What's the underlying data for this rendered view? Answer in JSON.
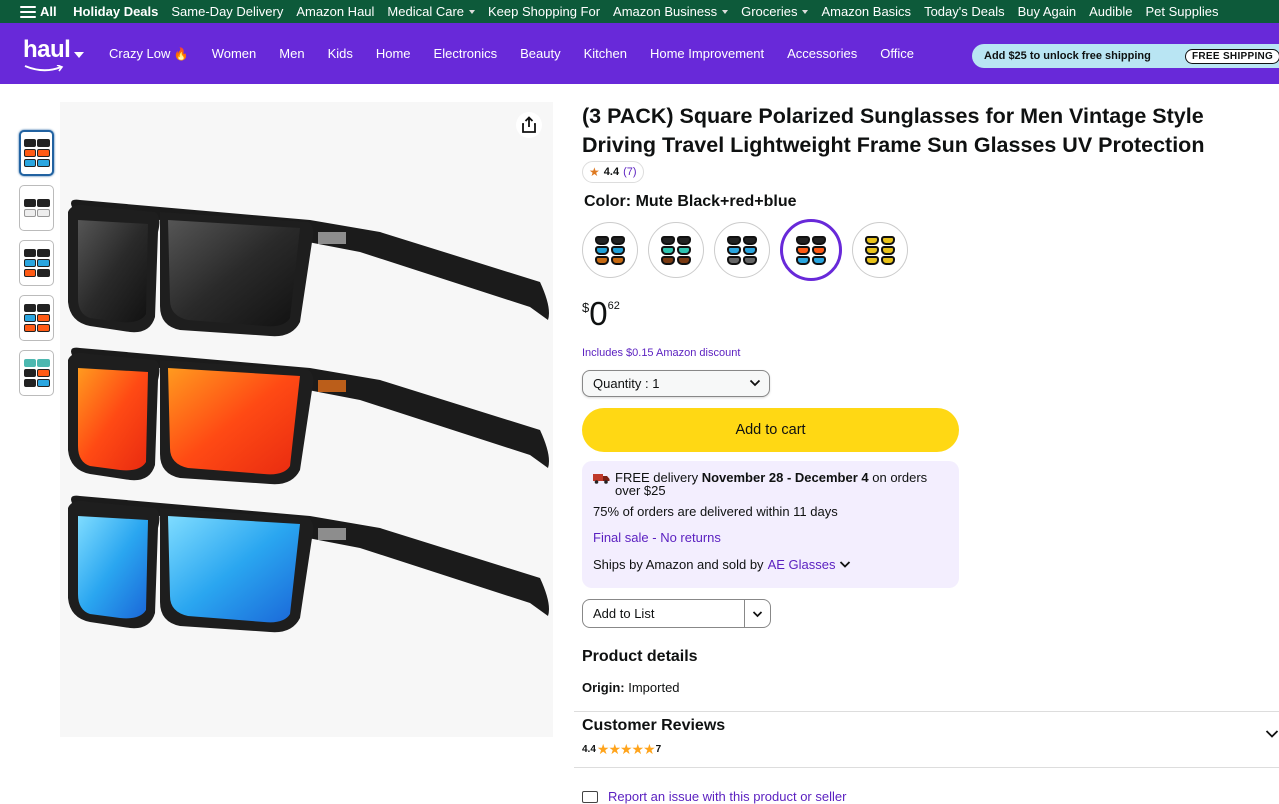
{
  "topnav": {
    "all_label": "All",
    "items": [
      {
        "label": "Holiday Deals",
        "bold": true,
        "caret": false
      },
      {
        "label": "Same-Day Delivery",
        "bold": false,
        "caret": false
      },
      {
        "label": "Amazon Haul",
        "bold": false,
        "caret": false
      },
      {
        "label": "Medical Care",
        "bold": false,
        "caret": true
      },
      {
        "label": "Keep Shopping For",
        "bold": false,
        "caret": false
      },
      {
        "label": "Amazon Business",
        "bold": false,
        "caret": true
      },
      {
        "label": "Groceries",
        "bold": false,
        "caret": true
      },
      {
        "label": "Amazon Basics",
        "bold": false,
        "caret": false
      },
      {
        "label": "Today's Deals",
        "bold": false,
        "caret": false
      },
      {
        "label": "Buy Again",
        "bold": false,
        "caret": false
      },
      {
        "label": "Audible",
        "bold": false,
        "caret": false
      },
      {
        "label": "Pet Supplies",
        "bold": false,
        "caret": false
      }
    ]
  },
  "haulbar": {
    "logo": "haul",
    "categories": [
      "Crazy Low",
      "Women",
      "Men",
      "Kids",
      "Home",
      "Electronics",
      "Beauty",
      "Kitchen",
      "Home Improvement",
      "Accessories",
      "Office"
    ],
    "shipping_banner": "Add $25 to unlock free shipping",
    "shipping_pill": "FREE SHIPPING"
  },
  "product": {
    "title": "(3 PACK) Square Polarized Sunglasses for Men Vintage Style Driving Travel Lightweight Frame Sun Glasses UV Protection",
    "rating": "4.4",
    "rating_count": "(7)",
    "color_label": "Color:",
    "color_value": "Mute Black+red+blue",
    "swatches": [
      {
        "lenses": [
          "#222",
          "#1e9fd6",
          "#c76a12"
        ]
      },
      {
        "lenses": [
          "#222",
          "#2ec4b0",
          "#7a3a12"
        ]
      },
      {
        "lenses": [
          "#222",
          "#2aa6e0",
          "#666"
        ]
      },
      {
        "lenses": [
          "#222",
          "#ff5a14",
          "#2aa6e0"
        ],
        "selected": true
      },
      {
        "lenses": [
          "#e8c21a",
          "#e8c21a",
          "#e8c21a"
        ]
      }
    ],
    "price_symbol": "$",
    "price_whole": "0",
    "price_fraction": "62",
    "discount_note": "Includes $0.15 Amazon discount",
    "quantity_label": "Quantity :",
    "quantity_value": "1",
    "add_to_cart": "Add to cart",
    "delivery": {
      "free_prefix": "FREE delivery",
      "dates": "November 28 - December 4",
      "suffix": "on orders over $25",
      "pct_line": "75% of orders are delivered within 11 days",
      "final_sale": "Final sale - No returns",
      "ships_by": "Ships by Amazon and sold by",
      "seller": "AE Glasses"
    },
    "add_to_list": "Add to List",
    "details_heading": "Product details",
    "origin_label": "Origin:",
    "origin_value": "Imported"
  },
  "reviews": {
    "heading": "Customer Reviews",
    "rating": "4.4",
    "stars": "★★★★★",
    "count": "7"
  },
  "report": {
    "label": "Report an issue with this product or seller"
  },
  "colors": {
    "topnav_bg": "#0d5a3a",
    "haul_purple": "#6829d9",
    "link_purple": "#5a1fc0",
    "cart_yellow": "#ffd814",
    "delivery_bg": "#f3eefe"
  }
}
